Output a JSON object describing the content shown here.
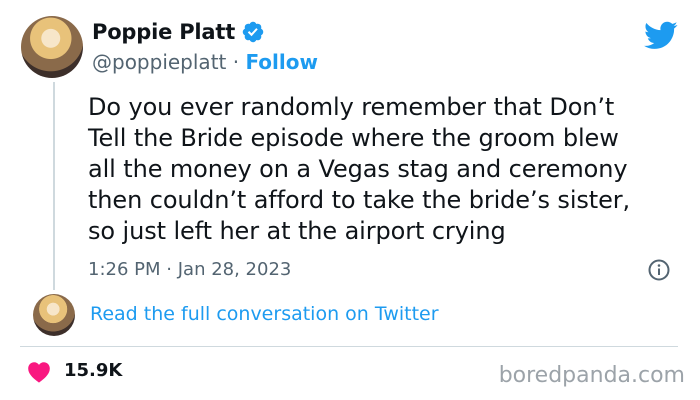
{
  "author": {
    "name": "Poppie Platt",
    "handle": "@poppieplatt",
    "separator": "·",
    "follow_label": "Follow"
  },
  "tweet": {
    "text": "Do you ever randomly remember that Don’t\nTell the Bride episode where the groom blew\nall the money on a Vegas stag and ceremony\nthen couldn’t afford to take the bride’s sister,\nso just left her at the airport crying",
    "time": "1:26 PM",
    "date_separator": "·",
    "date": "Jan 28, 2023"
  },
  "conversation": {
    "link_label": "Read the full conversation on Twitter"
  },
  "stats": {
    "likes": "15.9K"
  },
  "watermark": "boredpanda.com",
  "icons": {
    "verified": "verified-badge-icon",
    "bird": "twitter-bird-icon",
    "info": "info-icon",
    "heart": "heart-icon"
  },
  "colors": {
    "accent": "#1d9bf0",
    "text": "#0f1419",
    "muted": "#536471",
    "heart": "#f91880",
    "watermark": "#9ca3a9"
  }
}
